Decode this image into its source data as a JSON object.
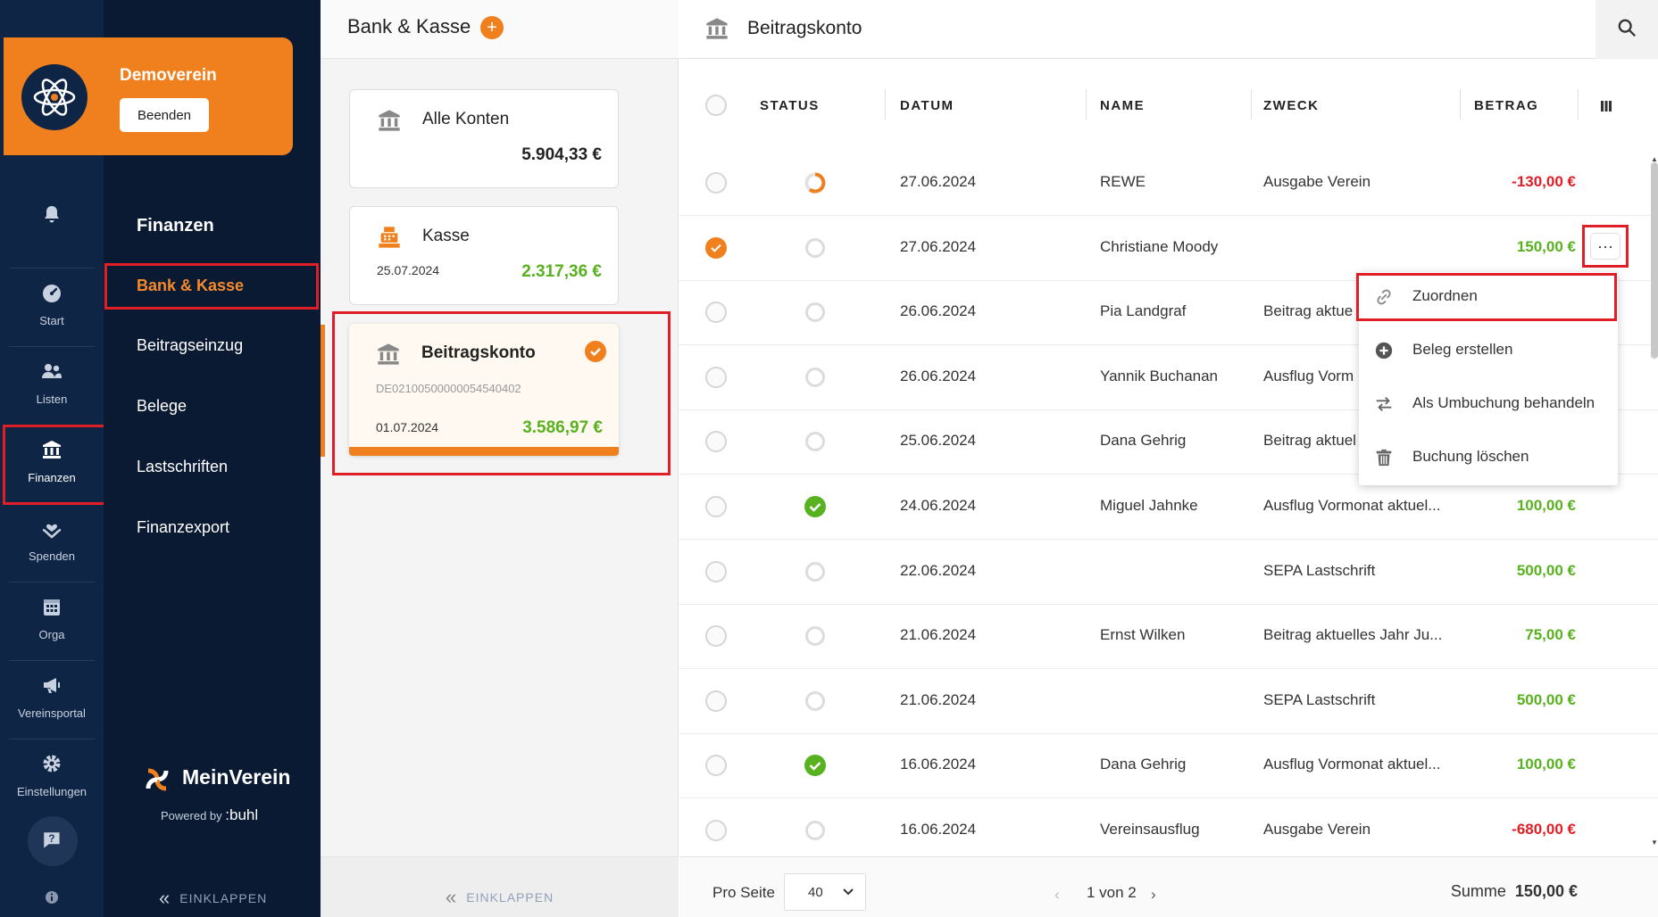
{
  "org": {
    "name": "Demoverein",
    "end_label": "Beenden"
  },
  "rail": [
    {
      "label": "",
      "icon": "bell-icon"
    },
    {
      "label": "Start",
      "icon": "dashboard-icon"
    },
    {
      "label": "Listen",
      "icon": "users-icon"
    },
    {
      "label": "Finanzen",
      "icon": "bank-icon"
    },
    {
      "label": "Spenden",
      "icon": "donation-icon"
    },
    {
      "label": "Orga",
      "icon": "calendar-icon"
    },
    {
      "label": "Vereinsportal",
      "icon": "megaphone-icon"
    },
    {
      "label": "Einstellungen",
      "icon": "gear-icon"
    }
  ],
  "nav": {
    "title": "Finanzen",
    "items": [
      "Bank & Kasse",
      "Beitragseinzug",
      "Belege",
      "Lastschriften",
      "Finanzexport"
    ],
    "collapse": "EINKLAPPEN"
  },
  "brand": {
    "name": "MeinVerein",
    "powered": "Powered by",
    "company": ":buhl"
  },
  "accounts": {
    "title": "Bank & Kasse",
    "add": "+",
    "collapse": "EINKLAPPEN",
    "cards": [
      {
        "name": "Alle Konten",
        "amount": "5.904,33 €"
      },
      {
        "name": "Kasse",
        "date": "25.07.2024",
        "amount": "2.317,36 €"
      },
      {
        "name": "Beitragskonto",
        "iban": "DE02100500000054540402",
        "date": "01.07.2024",
        "amount": "3.586,97 €"
      }
    ]
  },
  "main": {
    "title": "Beitragskonto",
    "columns": [
      "STATUS",
      "DATUM",
      "NAME",
      "ZWECK",
      "BETRAG"
    ],
    "rows": [
      {
        "status": "partial",
        "date": "27.06.2024",
        "name": "REWE",
        "purpose": "Ausgabe Verein",
        "amount": "-130,00 €",
        "neg": true
      },
      {
        "status": "open",
        "date": "27.06.2024",
        "name": "Christiane Moody",
        "purpose": "",
        "amount": "150,00 €",
        "neg": false,
        "selected": true
      },
      {
        "status": "open",
        "date": "26.06.2024",
        "name": "Pia Landgraf",
        "purpose": "Beitrag aktue",
        "amount": "",
        "neg": false
      },
      {
        "status": "open",
        "date": "26.06.2024",
        "name": "Yannik Buchanan",
        "purpose": "Ausflug Vorm",
        "amount": "",
        "neg": false
      },
      {
        "status": "open",
        "date": "25.06.2024",
        "name": "Dana Gehrig",
        "purpose": "Beitrag aktuel",
        "amount": "",
        "neg": false
      },
      {
        "status": "done",
        "date": "24.06.2024",
        "name": "Miguel Jahnke",
        "purpose": "Ausflug Vormonat aktuel...",
        "amount": "100,00 €",
        "neg": false
      },
      {
        "status": "open",
        "date": "22.06.2024",
        "name": "",
        "purpose": "SEPA Lastschrift",
        "amount": "500,00 €",
        "neg": false
      },
      {
        "status": "open",
        "date": "21.06.2024",
        "name": "Ernst Wilken",
        "purpose": "Beitrag aktuelles Jahr Ju...",
        "amount": "75,00 €",
        "neg": false
      },
      {
        "status": "open",
        "date": "21.06.2024",
        "name": "",
        "purpose": "SEPA Lastschrift",
        "amount": "500,00 €",
        "neg": false
      },
      {
        "status": "done",
        "date": "16.06.2024",
        "name": "Dana Gehrig",
        "purpose": "Ausflug Vormonat aktuel...",
        "amount": "100,00 €",
        "neg": false
      },
      {
        "status": "open",
        "date": "16.06.2024",
        "name": "Vereinsausflug",
        "purpose": "Ausgabe Verein",
        "amount": "-680,00 €",
        "neg": true
      }
    ],
    "menu": [
      "Zuordnen",
      "Beleg erstellen",
      "Als Umbuchung behandeln",
      "Buchung löschen"
    ],
    "more": "···",
    "footer": {
      "per_page_label": "Pro Seite",
      "per_page": "40",
      "page": "1 von 2",
      "sum_label": "Summe",
      "sum": "150,00 €"
    }
  },
  "colors": {
    "accent": "#f07f1d",
    "navy": "#0b1a33",
    "positive": "#58b11e",
    "negative": "#e01e26",
    "highlight": "#e01e26"
  }
}
